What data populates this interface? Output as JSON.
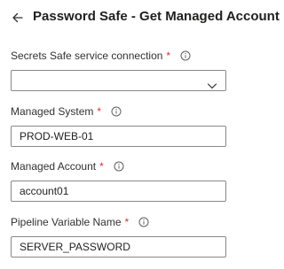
{
  "header": {
    "title": "Password Safe - Get Managed Account",
    "back_icon": "arrow-left-icon"
  },
  "fields": {
    "service_connection": {
      "label": "Secrets Safe service connection",
      "required_mark": "*",
      "value": ""
    },
    "managed_system": {
      "label": "Managed System",
      "required_mark": "*",
      "value": "PROD-WEB-01"
    },
    "managed_account": {
      "label": "Managed Account",
      "required_mark": "*",
      "value": "account01"
    },
    "pipeline_variable": {
      "label": "Pipeline Variable Name",
      "required_mark": "*",
      "value": "SERVER_PASSWORD"
    }
  },
  "colors": {
    "required": "#d13438",
    "border": "#8a8886",
    "text": "#323130"
  }
}
